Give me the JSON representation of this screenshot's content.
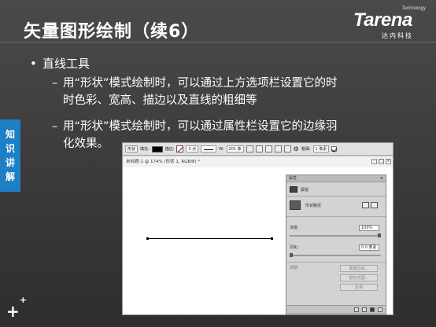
{
  "slide": {
    "title": "矢量图形绘制（续6）",
    "logo": {
      "technology": "Technology",
      "brand": "Tarena",
      "subtitle": "达内科技"
    },
    "bullet1": "直线工具",
    "bullet2_line1": "用“形状”模式绘制时，可以通过上方选项栏设置它的时",
    "bullet2_line2": "时色彩、宽高、描边以及直线的粗细等",
    "bullet3_line1": "用“形状”模式绘制时，可以通过属性栏设置它的边缘羽",
    "bullet3_line2": "化效果。",
    "side_tab": [
      "知",
      "识",
      "讲",
      "解"
    ],
    "plus_mark": "+"
  },
  "photoshop": {
    "options_bar": {
      "mode": "形状",
      "fill_label": "填充:",
      "stroke_label": "描边:",
      "stroke_width": "3 点",
      "w_label": "W:",
      "w_value": "201 像",
      "weight_label": "粗细:",
      "weight_value": "1 像素"
    },
    "doc_title": "未标题-1 @ 174% (形状 1, RGB/8) *",
    "window_buttons": [
      "–",
      "□",
      "×"
    ],
    "properties_panel": {
      "title": "属性",
      "menu": "≡",
      "mask_label": "蒙版",
      "shape_label": "形状路径",
      "density_label": "浓度:",
      "density_value": "100%",
      "density_fraction": 1.0,
      "feather_label": "羽化:",
      "feather_value": "0.0 像素",
      "feather_fraction": 0.0,
      "adjust_label": "调整:",
      "btn_mask_edge": "蒙版边缘...",
      "btn_color_range": "颜色范围...",
      "btn_invert": "反相"
    }
  }
}
